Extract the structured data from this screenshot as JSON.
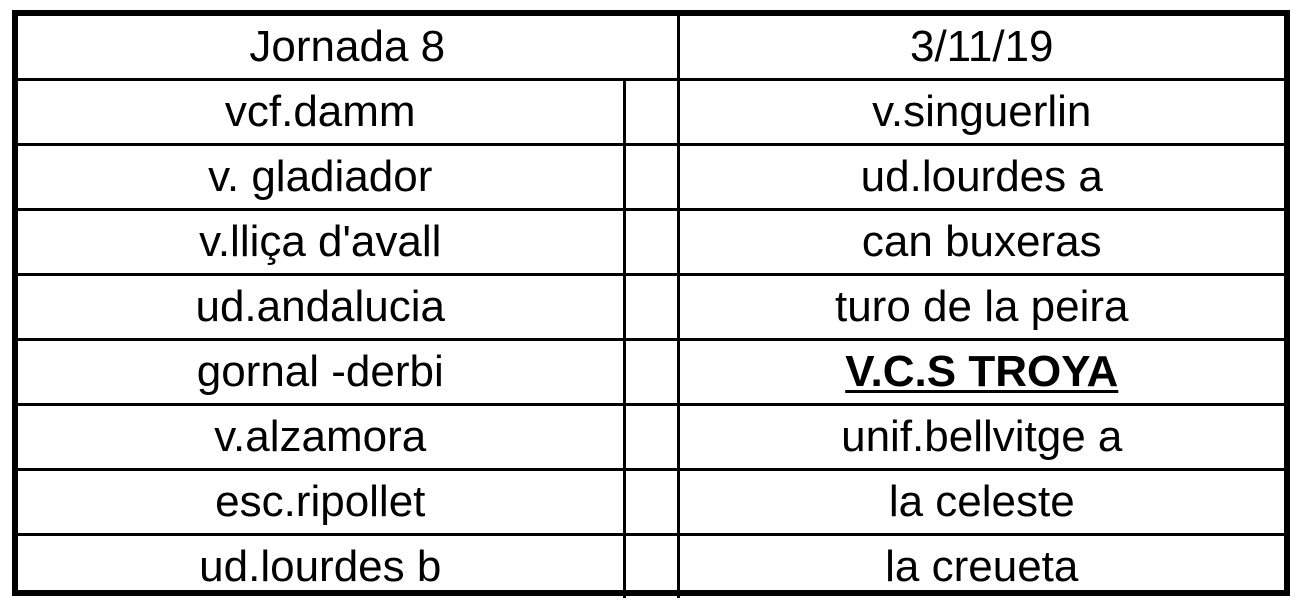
{
  "header": {
    "round_label": "Jornada 8",
    "date": "3/11/19"
  },
  "matches": [
    {
      "home": "vcf.damm",
      "away": "v.singuerlin"
    },
    {
      "home": "v. gladiador",
      "away": "ud.lourdes a"
    },
    {
      "home": "v.lliça d'avall",
      "away": "can buxeras"
    },
    {
      "home": "ud.andalucia",
      "away": "turo de la peira"
    },
    {
      "home": "gornal -derbi",
      "away": "V.C.S TROYA"
    },
    {
      "home": "v.alzamora",
      "away": "unif.bellvitge a"
    },
    {
      "home": "esc.ripollet",
      "away": "la celeste"
    },
    {
      "home": "ud.lourdes b",
      "away": "la creueta"
    }
  ]
}
